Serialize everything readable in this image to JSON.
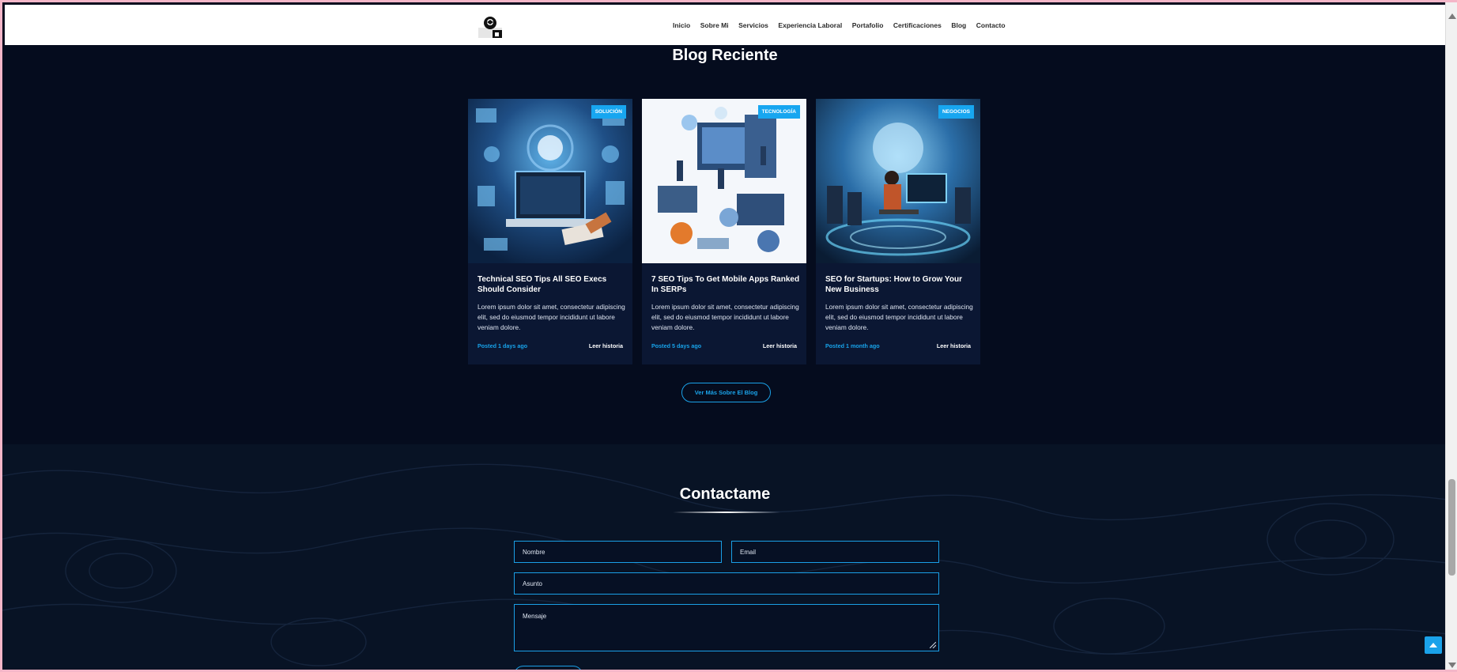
{
  "nav": {
    "links": [
      "Inicio",
      "Sobre Mi",
      "Servicios",
      "Experiencia Laboral",
      "Portafolio",
      "Certificaciones",
      "Blog",
      "Contacto"
    ]
  },
  "blog": {
    "title": "Blog Reciente",
    "cards": [
      {
        "badge": "SOLUCIÓN",
        "title": "Technical SEO Tips All SEO Execs Should Consider",
        "text": "Lorem ipsum dolor sit amet, consectetur adipiscing elit, sed do eiusmod tempor incididunt ut labore veniam dolore.",
        "posted": "Posted 1 days ago",
        "read": "Leer historia"
      },
      {
        "badge": "TECNOLOGÍA",
        "title": "7 SEO Tips To Get Mobile Apps Ranked In SERPs",
        "text": "Lorem ipsum dolor sit amet, consectetur adipiscing elit, sed do eiusmod tempor incididunt ut labore veniam dolore.",
        "posted": "Posted 5 days ago",
        "read": "Leer historia"
      },
      {
        "badge": "NEGOCIOS",
        "title": "SEO for Startups: How to Grow Your New Business",
        "text": "Lorem ipsum dolor sit amet, consectetur adipiscing elit, sed do eiusmod tempor incididunt ut labore veniam dolore.",
        "posted": "Posted 1 month ago",
        "read": "Leer historia"
      }
    ],
    "more_button": "Ver Más Sobre El Blog"
  },
  "contact": {
    "title": "Contactame",
    "name_placeholder": "Nombre",
    "email_placeholder": "Email",
    "subject_placeholder": "Asunto",
    "message_placeholder": "Mensaje"
  },
  "colors": {
    "accent": "#17a6f0",
    "background": "#050c1e",
    "card": "#0b1733"
  }
}
